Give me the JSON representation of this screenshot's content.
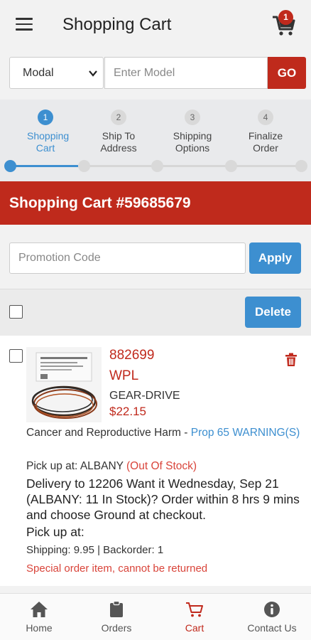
{
  "header": {
    "title": "Shopping Cart",
    "cart_count": "1"
  },
  "search": {
    "select_value": "Modal",
    "placeholder": "Enter Model",
    "go_label": "GO"
  },
  "steps": [
    {
      "num": "1",
      "label": "Shopping Cart"
    },
    {
      "num": "2",
      "label": "Ship To Address"
    },
    {
      "num": "3",
      "label": "Shipping Options"
    },
    {
      "num": "4",
      "label": "Finalize Order"
    }
  ],
  "progress": {
    "current_step": 1,
    "total_steps": 4
  },
  "cart": {
    "title": "Shopping Cart #59685679"
  },
  "promo": {
    "placeholder": "Promotion Code",
    "apply_label": "Apply"
  },
  "actions": {
    "delete_label": "Delete"
  },
  "item": {
    "part_number": "882699",
    "brand": "WPL",
    "description": "GEAR-DRIVE",
    "price": "$22.15",
    "warning_prefix": "Cancer and Reproductive Harm - ",
    "warning_link": "Prop 65 WARNING(S)",
    "pickup_prefix": "Pick up at: ALBANY ",
    "pickup_status": "(Out Of Stock)",
    "delivery": "Delivery to 12206 Want it Wednesday, Sep 21 (ALBANY: 11 In Stock)? Order within 8 hrs 9 mins and choose Ground at checkout.",
    "pickup_at": "Pick up at:",
    "shipping": "Shipping: 9.95 | Backorder: 1",
    "note": "Special order item, cannot be returned"
  },
  "nav": [
    {
      "label": "Home",
      "icon": "home-icon"
    },
    {
      "label": "Orders",
      "icon": "clipboard-icon"
    },
    {
      "label": "Cart",
      "icon": "cart-icon"
    },
    {
      "label": "Contact Us",
      "icon": "info-icon"
    }
  ],
  "colors": {
    "brand_red": "#bf2a1c",
    "accent_blue": "#3d8fd0"
  }
}
